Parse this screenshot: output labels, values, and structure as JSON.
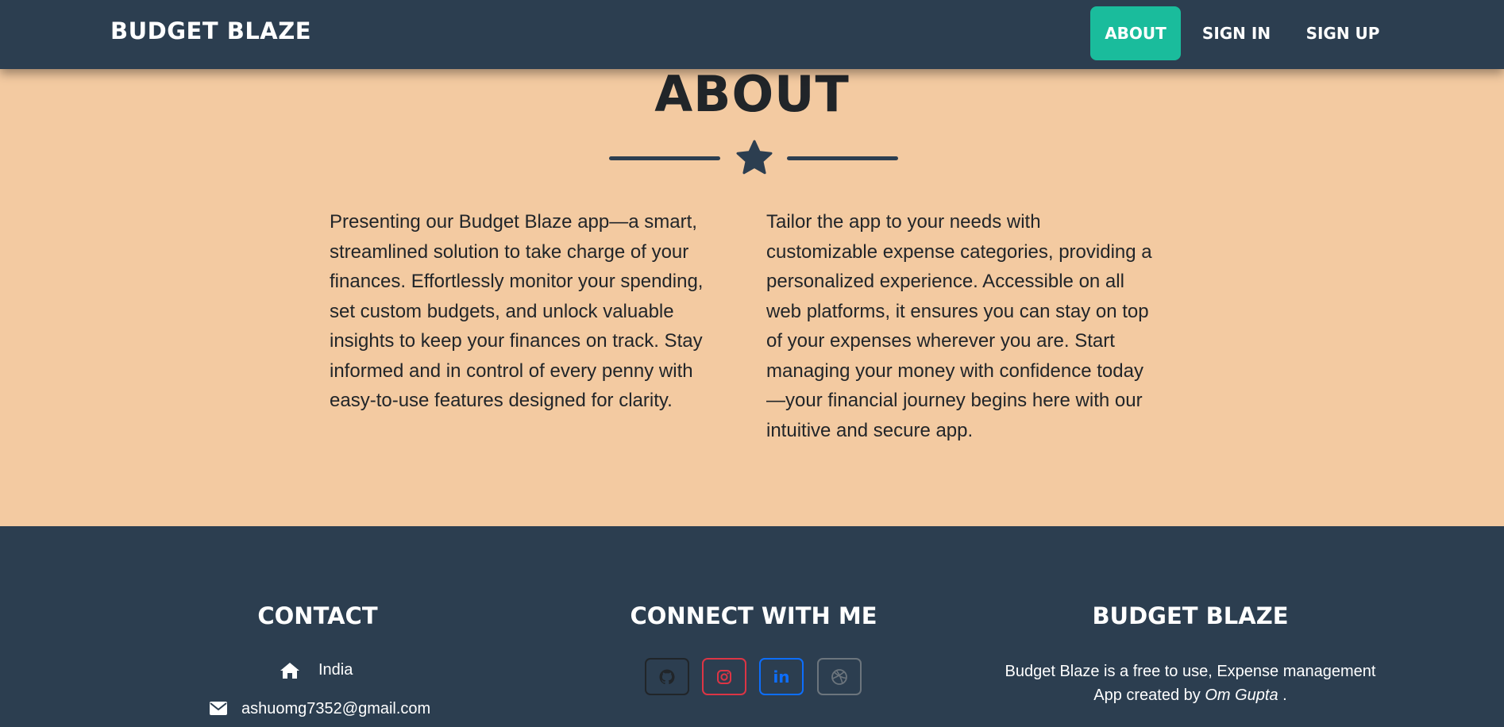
{
  "navbar": {
    "brand": "BUDGET BLAZE",
    "links": [
      {
        "label": "ABOUT",
        "active": true
      },
      {
        "label": "SIGN IN",
        "active": false
      },
      {
        "label": "SIGN UP",
        "active": false
      }
    ]
  },
  "about": {
    "title": "ABOUT",
    "divider_icon": "star-icon",
    "paragraph_left": "Presenting our Budget Blaze app—a smart, streamlined solution to take charge of your finances. Effortlessly monitor your spending, set custom budgets, and unlock valuable insights to keep your finances on track. Stay informed and in control of every penny with easy-to-use features designed for clarity.",
    "paragraph_right": "Tailor the app to your needs with customizable expense categories, providing a personalized experience. Accessible on all web platforms, it ensures you can stay on top of your expenses wherever you are. Start managing your money with confidence today—your financial journey begins here with our intuitive and secure app."
  },
  "footer": {
    "contact": {
      "heading": "CONTACT",
      "country_icon": "home-icon",
      "country": "India",
      "email_icon": "envelope-icon",
      "email": "ashuomg7352@gmail.com"
    },
    "connect": {
      "heading": "CONNECT WITH ME",
      "socials": [
        {
          "name": "github",
          "icon": "github-icon",
          "color": "#212529"
        },
        {
          "name": "instagram",
          "icon": "instagram-icon",
          "color": "#dc3545"
        },
        {
          "name": "linkedin",
          "icon": "linkedin-icon",
          "label": "in",
          "color": "#0d6efd"
        },
        {
          "name": "dribbble",
          "icon": "dribbble-icon",
          "color": "#6c757d"
        }
      ]
    },
    "brand": {
      "heading": "BUDGET BLAZE",
      "description_prefix": "Budget Blaze is a free to use, Expense management App created by ",
      "author": "Om Gupta",
      "description_suffix": " ."
    }
  },
  "colors": {
    "navbar_bg": "#2c3e50",
    "accent": "#1abc9c",
    "page_bg": "#f3caa1",
    "footer_bg": "#2c3e50"
  }
}
